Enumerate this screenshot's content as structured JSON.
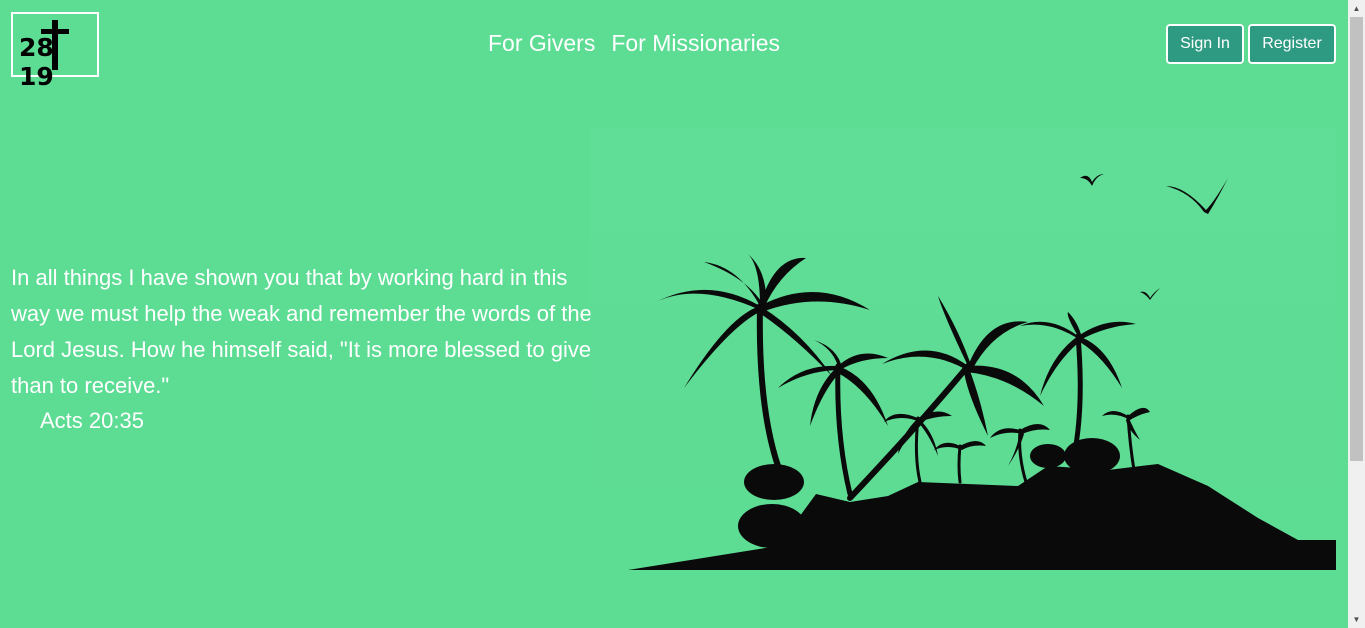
{
  "logo": {
    "left_number": "28",
    "right_number": "19"
  },
  "nav": {
    "items": [
      {
        "label": "For Givers"
      },
      {
        "label": "For Missionaries"
      }
    ]
  },
  "auth": {
    "sign_in_label": "Sign In",
    "register_label": "Register"
  },
  "hero": {
    "quote": "In all things I have shown you that by working hard in this way we must help the weak and remember the words of the Lord Jesus. How he himself said, \"It is more blessed to give than to receive.\"",
    "reference": "Acts 20:35"
  },
  "colors": {
    "background": "#5ddc94",
    "button": "#2f9a82",
    "text": "#ffffff",
    "silhouette": "#0b0a0b"
  },
  "icons": {
    "scroll_up": "scroll-up-arrow-icon",
    "scroll_down": "scroll-down-arrow-icon"
  }
}
